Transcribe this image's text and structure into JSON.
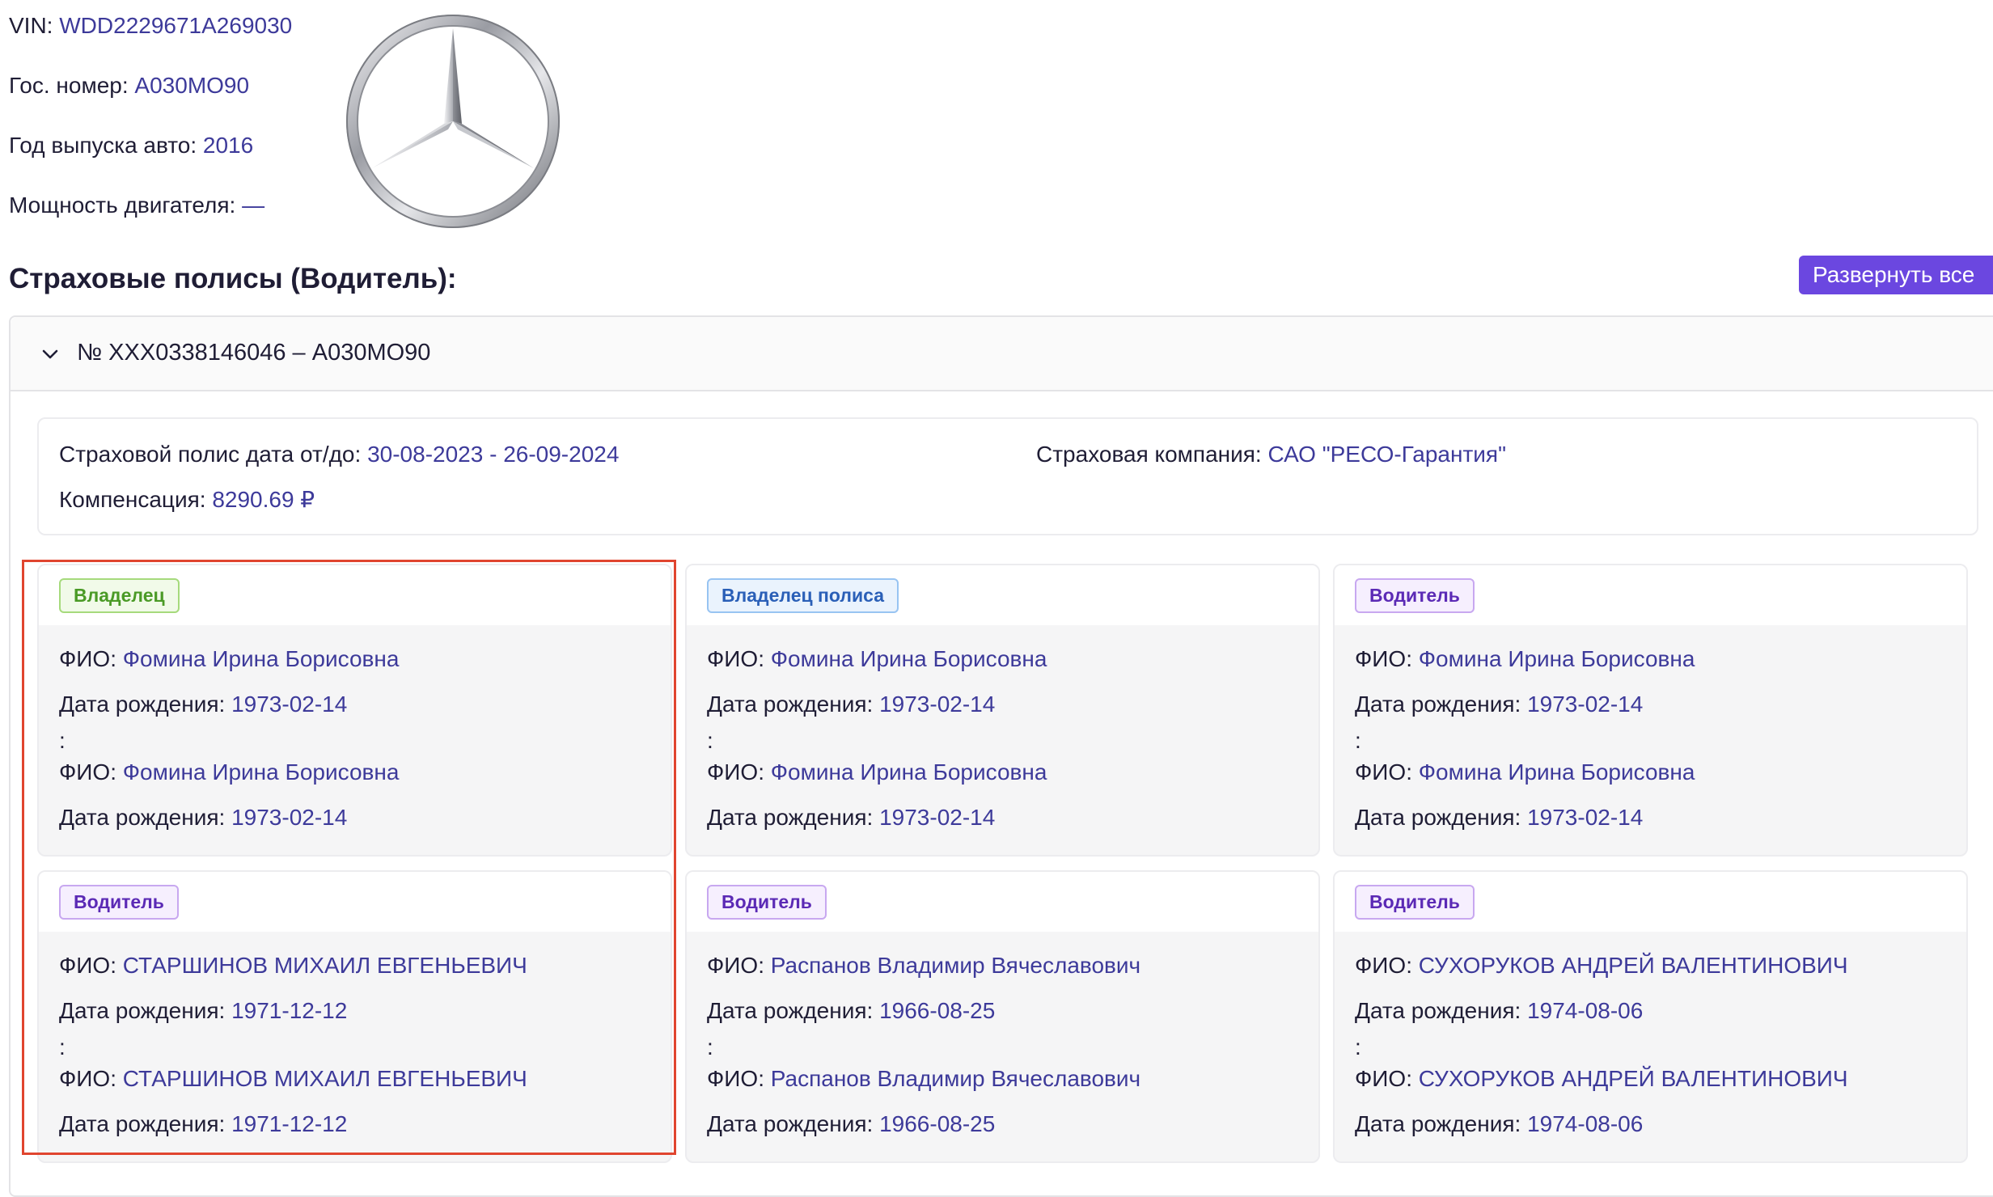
{
  "vehicle": {
    "vin_label": "VIN:",
    "vin": "WDD2229671A269030",
    "plate_label": "Гос. номер:",
    "plate": "А030МО90",
    "year_label": "Год выпуска авто:",
    "year": "2016",
    "power_label": "Мощность двигателя:",
    "power": "—",
    "logo_icon": "mercedes-benz-logo"
  },
  "section": {
    "title": "Страховые полисы (Водитель):",
    "expand_all_label": "Развернуть все"
  },
  "policy": {
    "header": "№ XXX0338146046 – А030МО90",
    "dates_label": "Страховой полис дата от/до:",
    "dates": "30-08-2023 - 26-09-2024",
    "company_label": "Страховая компания:",
    "company": "САО \"РЕСО-Гарантия\"",
    "compensation_label": "Компенсация:",
    "compensation": "8290.69 ₽"
  },
  "labels": {
    "fio": "ФИО:",
    "birth": "Дата рождения:",
    "colon": ":"
  },
  "cards": [
    {
      "role": "Владелец",
      "name": "Фомина Ирина Борисовна",
      "birth": "1973-02-14"
    },
    {
      "role": "Владелец полиса",
      "name": "Фомина Ирина Борисовна",
      "birth": "1973-02-14"
    },
    {
      "role": "Водитель",
      "name": "Фомина Ирина Борисовна",
      "birth": "1973-02-14"
    },
    {
      "role": "Водитель",
      "name": "СТАРШИНОВ МИХАИЛ ЕВГЕНЬЕВИЧ",
      "birth": "1971-12-12"
    },
    {
      "role": "Водитель",
      "name": "Распанов Владимир Вячеславович",
      "birth": "1966-08-25"
    },
    {
      "role": "Водитель",
      "name": "СУХОРУКОВ АНДРЕЙ ВАЛЕНТИНОВИЧ",
      "birth": "1974-08-06"
    }
  ],
  "colors": {
    "accent": "#6b47e0",
    "value_text": "#3d3a9a",
    "highlight_border": "#e0452f"
  }
}
